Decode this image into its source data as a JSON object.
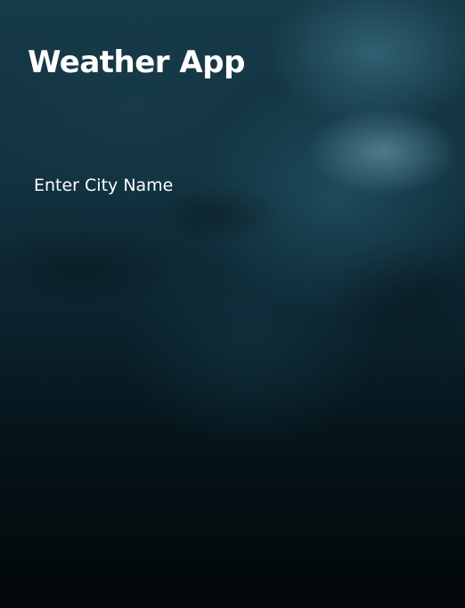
{
  "app": {
    "title": "Weather App"
  },
  "search": {
    "label": "Enter City Name"
  }
}
